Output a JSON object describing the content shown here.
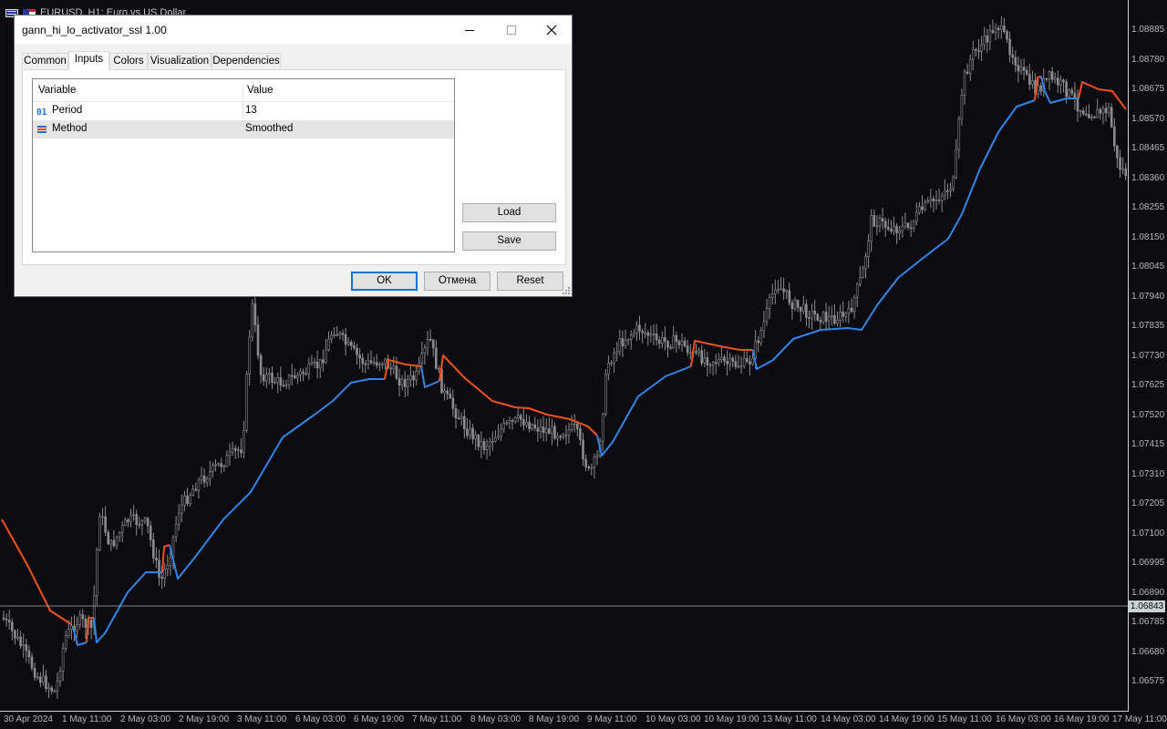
{
  "chart": {
    "symbol_title": "EURUSD, H1:  Euro vs US Dollar",
    "current_price": "1.06843",
    "colors": {
      "background": "#0b0b10",
      "candles": "#8c8c8c",
      "ssl_up": "#2f86e8",
      "ssl_down": "#f0521e",
      "bid_line": "#9aa8ad"
    },
    "price_levels": [
      "1.08885",
      "1.08780",
      "1.08675",
      "1.08570",
      "1.08465",
      "1.08360",
      "1.08255",
      "1.08150",
      "1.08045",
      "1.07940",
      "1.07835",
      "1.07730",
      "1.07625",
      "1.07520",
      "1.07415",
      "1.07310",
      "1.07205",
      "1.07100",
      "1.06995",
      "1.06890",
      "1.06785",
      "1.06680",
      "1.06575"
    ],
    "time_labels": [
      "30 Apr 2024",
      "1 May 11:00",
      "2 May 03:00",
      "2 May 19:00",
      "3 May 11:00",
      "6 May 03:00",
      "6 May 19:00",
      "7 May 11:00",
      "8 May 03:00",
      "8 May 19:00",
      "9 May 11:00",
      "10 May 03:00",
      "10 May 19:00",
      "13 May 11:00",
      "14 May 03:00",
      "14 May 19:00",
      "15 May 11:00",
      "16 May 03:00",
      "16 May 19:00",
      "17 May 11:00"
    ]
  },
  "dialog": {
    "title": "gann_hi_lo_activator_ssl 1.00",
    "tabs": [
      "Common",
      "Inputs",
      "Colors",
      "Visualization",
      "Dependencies"
    ],
    "active_tab": "Inputs",
    "grid": {
      "headers": {
        "variable": "Variable",
        "value": "Value"
      },
      "rows": [
        {
          "icon": "int-param-icon",
          "badge": "01",
          "name": "Period",
          "value": "13"
        },
        {
          "icon": "enum-param-icon",
          "name": "Method",
          "value": "Smoothed"
        }
      ]
    },
    "buttons": {
      "load": "Load",
      "save": "Save",
      "ok": "OK",
      "cancel": "Отмена",
      "reset": "Reset"
    }
  }
}
